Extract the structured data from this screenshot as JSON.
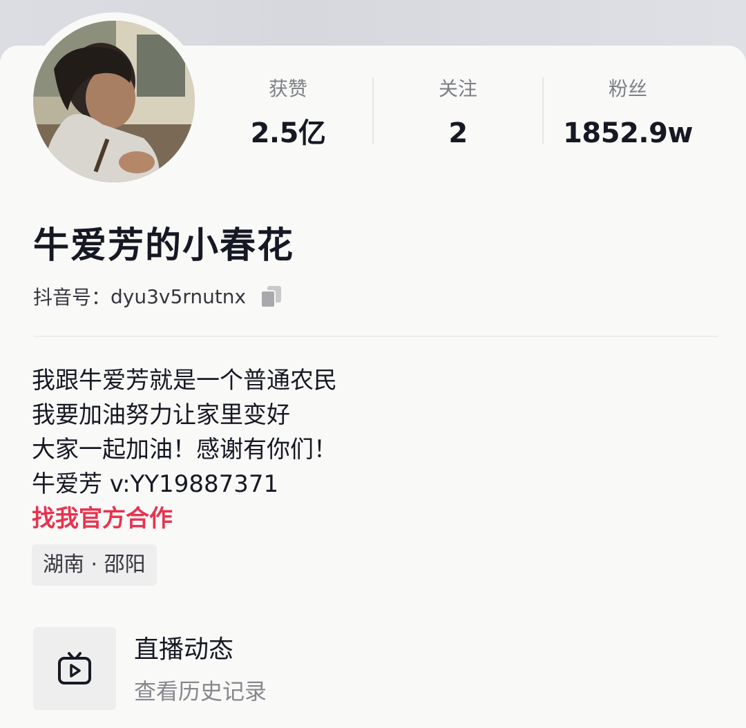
{
  "profile": {
    "avatar_alt": "avatar",
    "nickname": "牛爱芳的小春花",
    "douyin_id_label": "抖音号：",
    "douyin_id": "dyu3v5rnutnx"
  },
  "stats": [
    {
      "label": "获赞",
      "value": "2.5亿"
    },
    {
      "label": "关注",
      "value": "2"
    },
    {
      "label": "粉丝",
      "value": "1852.9w"
    }
  ],
  "bio": {
    "lines": [
      "我跟牛爱芳就是一个普通农民",
      "我要加油努力让家里变好",
      "大家一起加油！感谢有你们！",
      "牛爱芳 v:YY19887371"
    ],
    "cooperation_link": "找我官方合作"
  },
  "location": "湖南 · 邵阳",
  "live": {
    "title": "直播动态",
    "subtitle": "查看历史记录",
    "icon": "tv-play-icon"
  },
  "icons": {
    "copy": "copy-icon"
  },
  "colors": {
    "accent_link": "#e8334f",
    "text_primary": "#161823",
    "text_secondary": "#7d7f86"
  }
}
